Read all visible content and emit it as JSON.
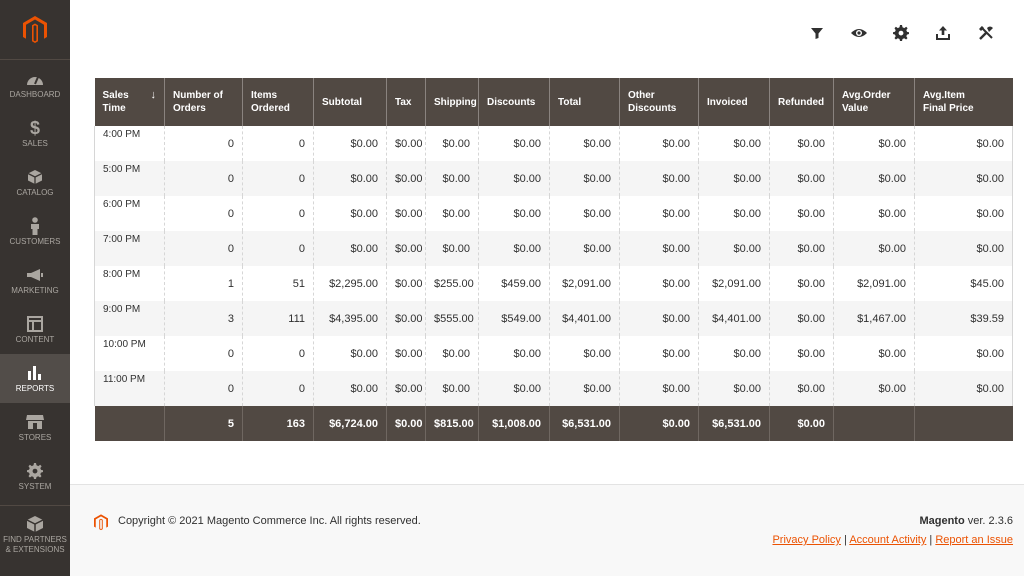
{
  "sidebar": {
    "items": [
      {
        "label": "DASHBOARD",
        "icon": "dashboard-icon"
      },
      {
        "label": "SALES",
        "icon": "dollar-icon"
      },
      {
        "label": "CATALOG",
        "icon": "cube-icon"
      },
      {
        "label": "CUSTOMERS",
        "icon": "person-icon"
      },
      {
        "label": "MARKETING",
        "icon": "megaphone-icon"
      },
      {
        "label": "CONTENT",
        "icon": "layout-icon"
      },
      {
        "label": "REPORTS",
        "icon": "bar-chart-icon"
      },
      {
        "label": "STORES",
        "icon": "store-icon"
      },
      {
        "label": "SYSTEM",
        "icon": "gear-icon"
      }
    ],
    "partners_line1": "FIND PARTNERS",
    "partners_line2": "& EXTENSIONS",
    "active": "REPORTS",
    "accent": "#eb5202"
  },
  "toolbar": [
    "filter-icon",
    "eye-icon",
    "settings-gear-icon",
    "export-icon",
    "tools-icon"
  ],
  "table": {
    "headers": [
      [
        "Sales",
        "Time"
      ],
      [
        "Number of",
        "Orders"
      ],
      [
        "Items",
        "Ordered"
      ],
      [
        "Subtotal",
        ""
      ],
      [
        "Tax",
        ""
      ],
      [
        "Shipping",
        ""
      ],
      [
        "Discounts",
        ""
      ],
      [
        "Total",
        ""
      ],
      [
        "Other",
        "Discounts"
      ],
      [
        "Invoiced",
        ""
      ],
      [
        "Refunded",
        ""
      ],
      [
        "Avg.Order",
        "Value"
      ],
      [
        "Avg.Item",
        "Final Price"
      ]
    ],
    "sort_arrow": "↓",
    "rows": [
      [
        "4:00 PM",
        "0",
        "0",
        "$0.00",
        "$0.00",
        "$0.00",
        "$0.00",
        "$0.00",
        "$0.00",
        "$0.00",
        "$0.00",
        "$0.00",
        "$0.00"
      ],
      [
        "5:00 PM",
        "0",
        "0",
        "$0.00",
        "$0.00",
        "$0.00",
        "$0.00",
        "$0.00",
        "$0.00",
        "$0.00",
        "$0.00",
        "$0.00",
        "$0.00"
      ],
      [
        "6:00 PM",
        "0",
        "0",
        "$0.00",
        "$0.00",
        "$0.00",
        "$0.00",
        "$0.00",
        "$0.00",
        "$0.00",
        "$0.00",
        "$0.00",
        "$0.00"
      ],
      [
        "7:00 PM",
        "0",
        "0",
        "$0.00",
        "$0.00",
        "$0.00",
        "$0.00",
        "$0.00",
        "$0.00",
        "$0.00",
        "$0.00",
        "$0.00",
        "$0.00"
      ],
      [
        "8:00 PM",
        "1",
        "51",
        "$2,295.00",
        "$0.00",
        "$255.00",
        "$459.00",
        "$2,091.00",
        "$0.00",
        "$2,091.00",
        "$0.00",
        "$2,091.00",
        "$45.00"
      ],
      [
        "9:00 PM",
        "3",
        "111",
        "$4,395.00",
        "$0.00",
        "$555.00",
        "$549.00",
        "$4,401.00",
        "$0.00",
        "$4,401.00",
        "$0.00",
        "$1,467.00",
        "$39.59"
      ],
      [
        "10:00 PM",
        "0",
        "0",
        "$0.00",
        "$0.00",
        "$0.00",
        "$0.00",
        "$0.00",
        "$0.00",
        "$0.00",
        "$0.00",
        "$0.00",
        "$0.00"
      ],
      [
        "11:00 PM",
        "0",
        "0",
        "$0.00",
        "$0.00",
        "$0.00",
        "$0.00",
        "$0.00",
        "$0.00",
        "$0.00",
        "$0.00",
        "$0.00",
        "$0.00"
      ]
    ],
    "totals": [
      "",
      "5",
      "163",
      "$6,724.00",
      "$0.00",
      "$815.00",
      "$1,008.00",
      "$6,531.00",
      "$0.00",
      "$6,531.00",
      "$0.00",
      "",
      ""
    ]
  },
  "footer": {
    "copyright": "Copyright © 2021 Magento Commerce Inc. All rights reserved.",
    "brand": "Magento",
    "version": " ver. 2.3.6",
    "links": [
      "Privacy Policy",
      "Account Activity",
      "Report an Issue"
    ]
  }
}
